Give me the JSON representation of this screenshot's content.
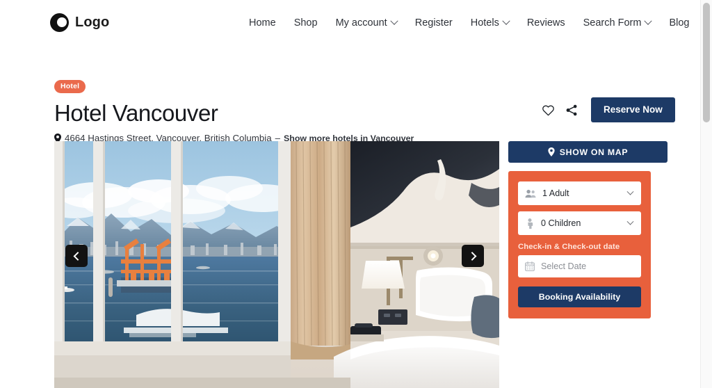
{
  "header": {
    "logo_text": "Logo",
    "nav": [
      {
        "label": "Home",
        "has_dropdown": false
      },
      {
        "label": "Shop",
        "has_dropdown": false
      },
      {
        "label": "My account",
        "has_dropdown": true
      },
      {
        "label": "Register",
        "has_dropdown": false
      },
      {
        "label": "Hotels",
        "has_dropdown": true
      },
      {
        "label": "Reviews",
        "has_dropdown": false
      },
      {
        "label": "Search Form",
        "has_dropdown": true
      },
      {
        "label": "Blog",
        "has_dropdown": false
      }
    ]
  },
  "hotel": {
    "badge": "Hotel",
    "title": "Hotel Vancouver",
    "address": "4664 Hastings Street, Vancouver, British Columbia",
    "address_separator": "–",
    "address_link": "Show more hotels in Vancouver",
    "reserve_label": "Reserve Now",
    "favorite_icon": "heart-icon",
    "share_icon": "share-icon",
    "location_icon": "map-pin-icon"
  },
  "gallery": {
    "alt": "Hotel room with window view of mountains, harbour and port cranes",
    "prev_label": "‹",
    "next_label": "›"
  },
  "sidebar": {
    "show_on_map": "SHOW ON MAP",
    "show_on_map_icon": "map-pin-icon",
    "booking": {
      "adults": {
        "value": "1 Adult",
        "icon": "people-icon"
      },
      "children": {
        "value": "0 Children",
        "icon": "child-icon"
      },
      "date_label": "Check-in & Check-out date",
      "date_placeholder": "Select Date",
      "date_icon": "calendar-icon",
      "submit_label": "Booking Availability"
    }
  },
  "colors": {
    "navy": "#1d3a66",
    "orange": "#e8603c",
    "badge": "#ea6a4c",
    "text": "#2e3239"
  }
}
